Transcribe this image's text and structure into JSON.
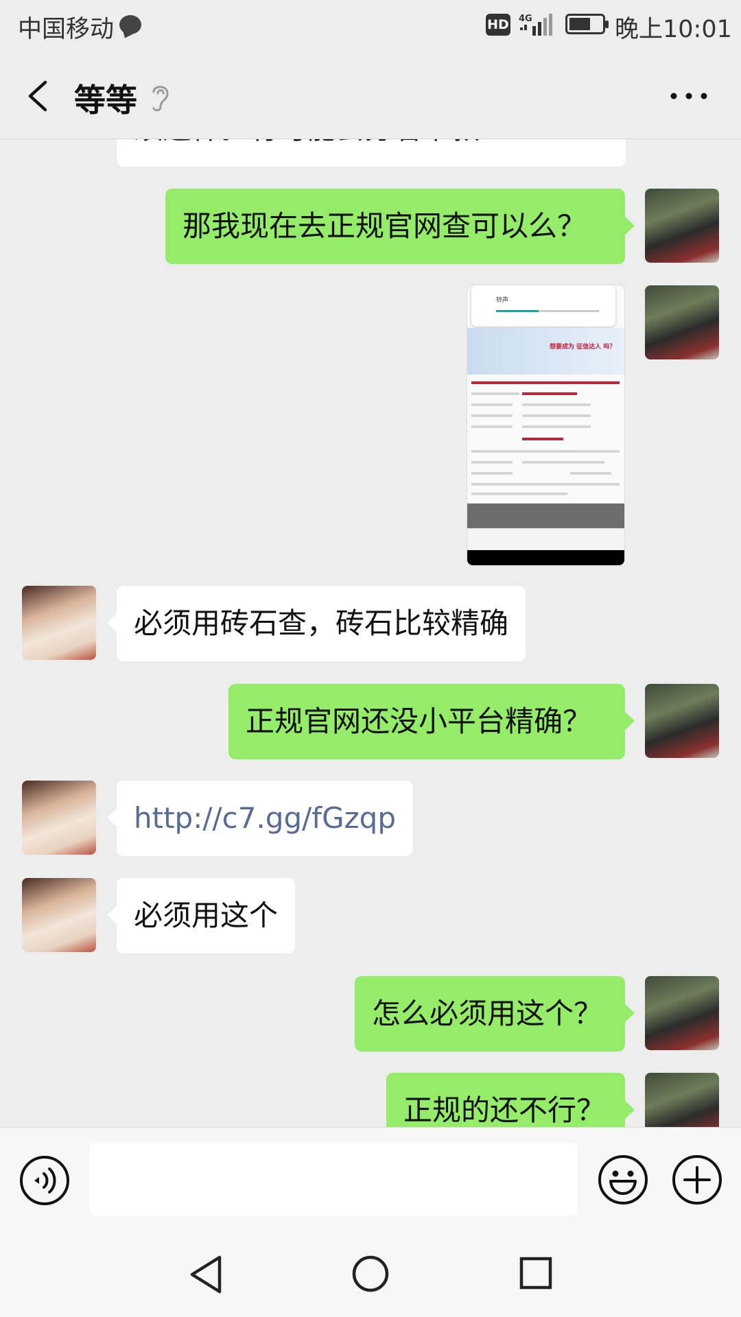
{
  "status_bar": {
    "carrier": "中国移动",
    "hd": "HD",
    "network": "4G",
    "time": "晚上10:01"
  },
  "header": {
    "title": "等等"
  },
  "messages": [
    {
      "side": "in",
      "type": "text",
      "text": "须这样。有可能会分着下款"
    },
    {
      "side": "out",
      "type": "text",
      "text": "那我现在去正规官网查可以么？"
    },
    {
      "side": "out",
      "type": "image",
      "image": {
        "volume_label": "铃声",
        "banner_text": "想要成为 征信达人 吗？"
      }
    },
    {
      "side": "in",
      "type": "text",
      "text": "必须用砖石查，砖石比较精确"
    },
    {
      "side": "out",
      "type": "text",
      "text": "正规官网还没小平台精确？"
    },
    {
      "side": "in",
      "type": "link",
      "text": "http://c7.gg/fGzqp"
    },
    {
      "side": "in",
      "type": "text",
      "text": "必须用这个"
    },
    {
      "side": "out",
      "type": "text",
      "text": "怎么必须用这个？"
    },
    {
      "side": "out",
      "type": "text",
      "text": "正规的还不行？"
    }
  ],
  "input_bar": {
    "placeholder": ""
  },
  "colors": {
    "outgoing_bubble": "#95ec69",
    "incoming_bubble": "#ffffff",
    "link": "#576b95",
    "background": "#ededed"
  }
}
